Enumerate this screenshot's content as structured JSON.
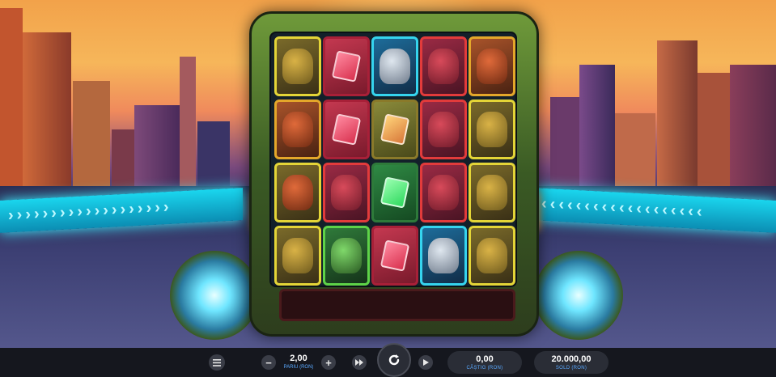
{
  "game": {
    "reels": [
      [
        "orange-goblin-yellow",
        "orange-goblin",
        "yellow-goblin",
        "yellow-goblin"
      ],
      [
        "red-gem",
        "red-gem",
        "red-goblin",
        "green-alien"
      ],
      [
        "cyan-robot",
        "gold-gem",
        "green-gem",
        "red-gem"
      ],
      [
        "red-goblin",
        "red-goblin",
        "red-goblin",
        "cyan-robot"
      ],
      [
        "orange-goblin",
        "yellow-goblin",
        "yellow-goblin",
        "yellow-goblin"
      ]
    ]
  },
  "controls": {
    "menu_icon": "menu-icon",
    "bet_value": "2,00",
    "bet_label": "PARIU (RON)",
    "minus_label": "−",
    "plus_label": "+",
    "turbo_icon": "fast-forward-icon",
    "spin_icon": "refresh-icon",
    "autoplay_icon": "play-icon",
    "win_value": "0,00",
    "win_label": "CÂȘTIG (RON)",
    "balance_value": "20.000,00",
    "balance_label": "SOLD (RON)"
  },
  "colors": {
    "accent": "#5aa9ff",
    "frame": "#4a7a2c",
    "rail": "#1ad6ee"
  }
}
